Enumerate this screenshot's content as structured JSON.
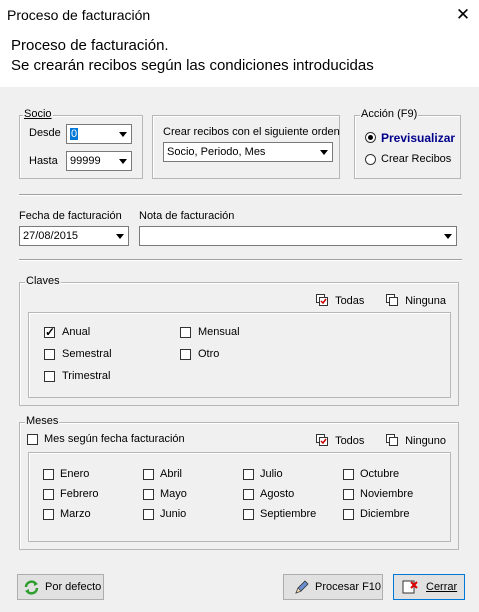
{
  "window": {
    "title": "Proceso de facturación",
    "close_glyph": "✕"
  },
  "header": {
    "line1": "Proceso de facturación.",
    "line2": "Se crearán recibos según las condiciones introducidas"
  },
  "socio": {
    "legend": "Socio",
    "desde_label": "Desde",
    "desde_value": "0",
    "hasta_label": "Hasta",
    "hasta_value": "99999"
  },
  "orden": {
    "label": "Crear recibos con el siguiente orden",
    "value": "Socio, Periodo, Mes"
  },
  "accion": {
    "legend": "Acción (F9)",
    "previsualizar": "Previsualizar",
    "crear": "Crear Recibos",
    "selected": "previsualizar"
  },
  "fecha": {
    "label": "Fecha de facturación",
    "value": "27/08/2015"
  },
  "nota": {
    "label": "Nota de facturación",
    "value": ""
  },
  "claves": {
    "legend": "Claves",
    "todas": "Todas",
    "ninguna": "Ninguna",
    "items": [
      {
        "label": "Anual",
        "checked": true
      },
      {
        "label": "Mensual",
        "checked": false
      },
      {
        "label": "Semestral",
        "checked": false
      },
      {
        "label": "Otro",
        "checked": false
      },
      {
        "label": "Trimestral",
        "checked": false
      }
    ]
  },
  "meses": {
    "legend": "Meses",
    "segun_fecha": "Mes según fecha facturación",
    "todos": "Todos",
    "ninguno": "Ninguno",
    "items": [
      "Enero",
      "Abril",
      "Julio",
      "Octubre",
      "Febrero",
      "Mayo",
      "Agosto",
      "Noviembre",
      "Marzo",
      "Junio",
      "Septiembre",
      "Diciembre"
    ]
  },
  "footer": {
    "por_defecto": "Por defecto",
    "procesar": "Procesar F10",
    "cerrar": "Cerrar"
  },
  "colors": {
    "accent_text": "#00008b",
    "body_bg": "#f0f0f0"
  }
}
